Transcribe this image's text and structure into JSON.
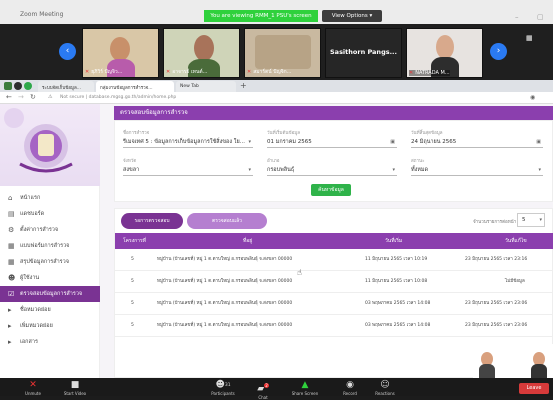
{
  "zoom": {
    "title": "Zoom Meeting",
    "banner": "You are viewing RMM_1 PSU's screen",
    "view_options": "View Options",
    "view_options_caret": "▾",
    "minimize": "–",
    "maximize": "▢",
    "nav_prev": "‹",
    "nav_next": "›",
    "participants": [
      {
        "name": "ยุภิวิร์ ปัญจิว..."
      },
      {
        "name": "อาจารย์ เทนต์..."
      },
      {
        "name": "สมาร์ตน์ ปัญจิก..."
      },
      {
        "name": "Sasithorn Pangs..."
      },
      {
        "name": "NATRADA M..."
      }
    ]
  },
  "browser": {
    "tabs": [
      {
        "label": "ระบบจัดเก็บข้อมูล..."
      },
      {
        "label": "กลุ่มงานข้อมูลการสำรวจ..."
      },
      {
        "label": "New Tab"
      }
    ],
    "address": "Not secure | database.mgsg.go.th/admin/home.php"
  },
  "sidebar": {
    "items": [
      {
        "label": "หน้าแรก",
        "icon": "home-icon",
        "glyph": "⌂"
      },
      {
        "label": "แดชบอร์ด",
        "icon": "chart-icon",
        "glyph": "▤"
      },
      {
        "label": "ตั้งค่าการสำรวจ",
        "icon": "settings-icon",
        "glyph": "⚙"
      },
      {
        "label": "แบบฟอร์มการสำรวจ",
        "icon": "document-icon",
        "glyph": "▦"
      },
      {
        "label": "สรุปข้อมูลการสำรวจ",
        "icon": "report-icon",
        "glyph": "▦"
      },
      {
        "label": "ผู้ใช้งาน",
        "icon": "users-icon",
        "glyph": "☻"
      },
      {
        "label": "ตรวจสอบข้อมูลการสำรวจ",
        "icon": "check-icon",
        "glyph": "☑",
        "active": true
      },
      {
        "label": "ชื่อหมวดย่อย",
        "icon": "folder-icon",
        "glyph": "▸"
      },
      {
        "label": "เพิ่มหมวดย่อย",
        "icon": "folder-icon",
        "glyph": "▸"
      },
      {
        "label": "เอกสาร",
        "icon": "file-icon",
        "glyph": "▸"
      }
    ]
  },
  "page": {
    "title": "ตรวจสอบข้อมูลการสำรวจ",
    "filters": {
      "survey_label": "ชื่อการสำรวจ",
      "survey_value": "รีเมจเทศ 5 : ข้อมูลการเก็บข้อมูลการใช้สิ่งของ ใย...",
      "start_label": "วันที่เริ่มต้นข้อมูล",
      "start_value": "01 มกราคม 2565",
      "end_label": "วันที่สิ้นสุดข้อมูล",
      "end_value": "24 มิถุนายน 2565",
      "province_label": "จังหวัด",
      "province_value": "สงขลา",
      "district_label": "อำเภอ",
      "district_value": "กรอบพลินธุ์",
      "status_label": "สถานะ",
      "status_value": "ทั้งหมด",
      "search_button": "ค้นหาข้อมูล"
    },
    "table": {
      "tab_pending": "รอการตรวจสอบ",
      "tab_done": "ตรวจสอบแล้ว",
      "per_page_label": "จำนวนรายการต่อหน้า",
      "per_page_value": "5",
      "headers": [
        "โครงการที่",
        "ที่อยู่",
        "วันที่เริ่ม",
        "วันที่แก้ไข"
      ],
      "rows": [
        {
          "no": "5",
          "address": "หมู่บ้าน (บ้านเลขที่) หมู่ 1 ต.ตาบใหญ่ อ.กรอบพลินธุ์ จ.สงขลา 00000",
          "start": "11 มิถุนายน 2565 เวลา 10:19",
          "edited": "23 มิถุนายน 2565 เวลา 23:16"
        },
        {
          "no": "5",
          "address": "หมู่บ้าน (บ้านเลขที่) หมู่ 1 ต.ตาบใหญ่ อ.กรอบพลินธุ์ จ.สงขลา 00000",
          "start": "11 มิถุนายน 2565 เวลา 10:08",
          "edited": "ไม่มีข้อมูล"
        },
        {
          "no": "5",
          "address": "หมู่บ้าน (บ้านเลขที่) หมู่ 1 ต.ตาบใหญ่ อ.กรอบพลินธุ์ จ.สงขลา 00000",
          "start": "03 พฤษภาคม 2565 เวลา 14:08",
          "edited": "23 มิถุนายน 2565 เวลา 23:06"
        },
        {
          "no": "5",
          "address": "หมู่บ้าน (บ้านเลขที่) หมู่ 1 ต.ตาบใหญ่ อ.กรอบพลินธุ์ จ.สงขลา 00000",
          "start": "03 พฤษภาคม 2565 เวลา 14:08",
          "edited": "23 มิถุนายน 2565 เวลา 23:06"
        }
      ]
    }
  },
  "toolbar": {
    "unmute": "Unmute",
    "start_video": "Start Video",
    "participants": "Participants",
    "participants_count": "31",
    "chat": "Chat",
    "chat_badge": "2",
    "share": "Share Screen",
    "record": "Record",
    "reactions": "Reactions",
    "leave": "Leave"
  },
  "colors": {
    "accent": "#8b3fae",
    "zoom_green": "#2fd13c",
    "leave_red": "#d73a3a",
    "search_green": "#2fb34a"
  }
}
